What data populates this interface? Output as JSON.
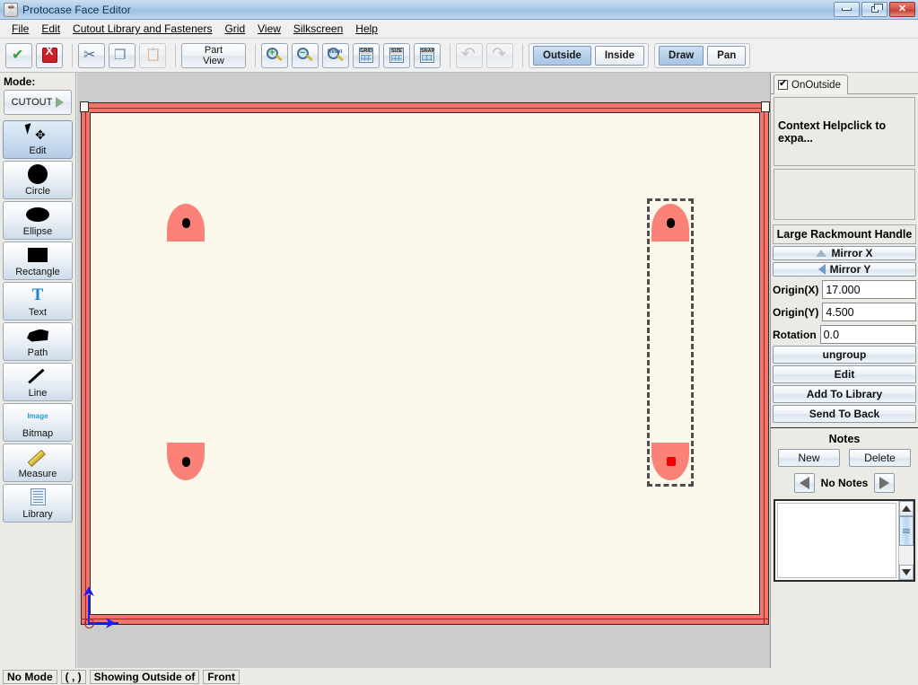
{
  "window": {
    "title": "Protocase Face Editor",
    "icon": "java-coffee-cup-icon",
    "minimize_label": "",
    "restore_label": "",
    "close_label": "✕"
  },
  "menubar": {
    "items": [
      {
        "label": "File",
        "mnemonic": "F"
      },
      {
        "label": "Edit",
        "mnemonic": "E"
      },
      {
        "label": "Cutout Library and Fasteners",
        "mnemonic": "C"
      },
      {
        "label": "Grid",
        "mnemonic": "G"
      },
      {
        "label": "View",
        "mnemonic": "V"
      },
      {
        "label": "Silkscreen",
        "mnemonic": "S"
      },
      {
        "label": "Help",
        "mnemonic": "H"
      }
    ]
  },
  "toolbar": {
    "buttons": [
      {
        "name": "accept-button",
        "icon": "green-check-icon",
        "enabled": true
      },
      {
        "name": "cancel-button",
        "icon": "red-x-icon",
        "enabled": true
      },
      {
        "name": "cut-button",
        "icon": "scissors-icon",
        "enabled": true
      },
      {
        "name": "copy-button",
        "icon": "copy-icon",
        "enabled": true
      },
      {
        "name": "paste-button",
        "icon": "paste-icon",
        "enabled": false
      }
    ],
    "part_view_label_line1": "Part",
    "part_view_label_line2": "View",
    "zoom_buttons": [
      {
        "name": "zoom-in-button",
        "icon": "magnifier-plus-icon"
      },
      {
        "name": "zoom-out-button",
        "icon": "magnifier-minus-icon"
      },
      {
        "name": "zoom-reset-button",
        "icon": "magnifier-reset-icon",
        "glyph": "Reset"
      }
    ],
    "toggle_buttons": [
      {
        "name": "grid-button",
        "icon": "grid-icon",
        "glyph": "GRID"
      },
      {
        "name": "size-button",
        "icon": "size-icon",
        "glyph": "SIZE"
      },
      {
        "name": "snap-button",
        "icon": "snap-icon",
        "glyph": "SNAP"
      }
    ],
    "undo_label": "",
    "redo_label": "",
    "side_group": {
      "outside_label": "Outside",
      "inside_label": "Inside",
      "selected": "Outside"
    },
    "mouse_group": {
      "draw_label": "Draw",
      "pan_label": "Pan",
      "selected": "Draw"
    }
  },
  "sidebar": {
    "mode_label": "Mode:",
    "mode_value": "CUTOUT",
    "tools": [
      {
        "label": "Edit",
        "icon": "cursor-move-icon",
        "selected": true
      },
      {
        "label": "Circle",
        "icon": "circle-icon",
        "selected": false
      },
      {
        "label": "Ellipse",
        "icon": "ellipse-icon",
        "selected": false
      },
      {
        "label": "Rectangle",
        "icon": "rectangle-icon",
        "selected": false
      },
      {
        "label": "Text",
        "icon": "text-t-icon",
        "selected": false
      },
      {
        "label": "Path",
        "icon": "path-polygon-icon",
        "selected": false
      },
      {
        "label": "Line",
        "icon": "line-icon",
        "selected": false
      },
      {
        "label": "Bitmap",
        "icon": "image-icon",
        "selected": false
      },
      {
        "label": "Measure",
        "icon": "ruler-icon",
        "selected": false
      },
      {
        "label": "Library",
        "icon": "library-list-icon",
        "selected": false
      }
    ]
  },
  "rightpanel": {
    "tab": {
      "label": "OnOutside",
      "checked": true
    },
    "context_help": "Context Helpclick to expa...",
    "selection_title": "Large Rackmount Handle",
    "mirror_x_label": "Mirror X",
    "mirror_y_label": "Mirror Y",
    "fields": [
      {
        "label": "Origin(X)",
        "value": "17.000"
      },
      {
        "label": "Origin(Y)",
        "value": "4.500"
      },
      {
        "label": "Rotation",
        "value": "0.0"
      }
    ],
    "actions": [
      {
        "label": "ungroup",
        "name": "ungroup-button"
      },
      {
        "label": "Edit",
        "name": "edit-object-button"
      },
      {
        "label": "Add To Library",
        "name": "add-to-library-button"
      },
      {
        "label": "Send To Back",
        "name": "send-to-back-button"
      }
    ],
    "notes": {
      "title": "Notes",
      "new_label": "New",
      "delete_label": "Delete",
      "status": "No Notes",
      "text": ""
    }
  },
  "statusbar": {
    "mode": "No Mode",
    "coords": "( , )",
    "showing": "Showing Outside of",
    "face": "Front"
  },
  "canvas": {
    "face_color": "#fdf8ec",
    "frame_color": "#f4736b",
    "cutout_color": "#fa8279",
    "selection_color": "#4d4d4d",
    "origin_axis_color": "#1a1aff",
    "cutouts": [
      {
        "name": "dome-cutout-top-left",
        "shape": "dome-up",
        "marker": "black-dot"
      },
      {
        "name": "dome-cutout-bottom-left",
        "shape": "dome-down",
        "marker": "black-dot"
      },
      {
        "name": "dome-cutout-top-right",
        "shape": "dome-up",
        "marker": "black-dot",
        "selected": true
      },
      {
        "name": "dome-cutout-bottom-right",
        "shape": "dome-down",
        "marker": "red-square",
        "selected": true
      }
    ]
  }
}
